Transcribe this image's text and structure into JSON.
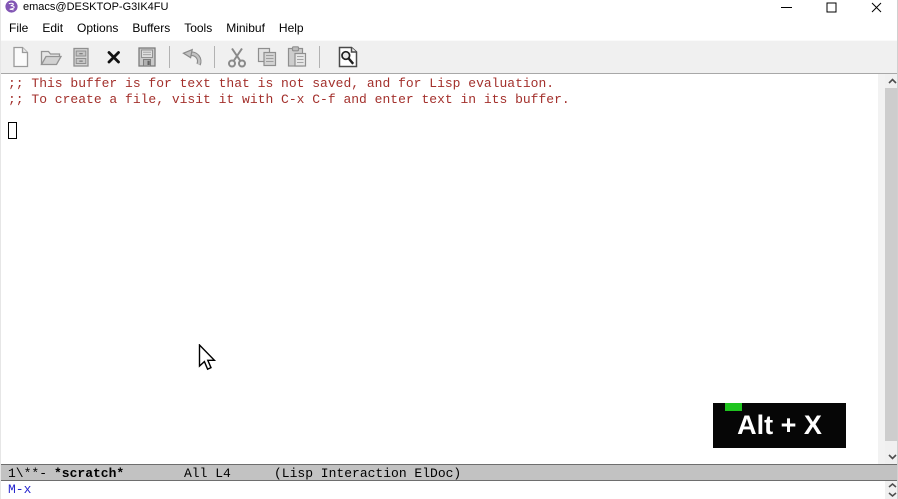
{
  "window": {
    "title": "emacs@DESKTOP-G3IK4FU",
    "controls": [
      {
        "name": "minimize"
      },
      {
        "name": "maximize"
      },
      {
        "name": "close"
      }
    ]
  },
  "menubar": {
    "items": [
      {
        "label": "File"
      },
      {
        "label": "Edit"
      },
      {
        "label": "Options"
      },
      {
        "label": "Buffers"
      },
      {
        "label": "Tools"
      },
      {
        "label": "Minibuf"
      },
      {
        "label": "Help"
      }
    ]
  },
  "toolbar": {
    "items": [
      {
        "name": "new-file-icon"
      },
      {
        "name": "open-folder-icon"
      },
      {
        "name": "dired-cabinet-icon"
      },
      {
        "name": "close-buffer-icon"
      },
      {
        "name": "save-floppy-icon"
      },
      {
        "name": "undo-arrow-icon"
      },
      {
        "name": "cut-scissors-icon"
      },
      {
        "name": "copy-icon"
      },
      {
        "name": "paste-clipboard-icon"
      },
      {
        "name": "isearch-magnifier-icon"
      }
    ]
  },
  "buffer": {
    "lines": [
      ";; This buffer is for text that is not saved, and for Lisp evaluation.",
      ";; To create a file, visit it with C-x C-f and enter text in its buffer."
    ],
    "comment_color": "#a3302c",
    "cursor_style": "hollow-box",
    "cursor_line": 4
  },
  "keycast": {
    "label": "Alt + X",
    "background": "#060606",
    "text_color": "#ffffff",
    "indicator_color": "#1fc41f"
  },
  "modeline": {
    "prefix": "1\\**-",
    "buffer_name": "*scratch*",
    "position": "All L4",
    "modes": "(Lisp Interaction ElDoc)",
    "background": "#c2c2c2"
  },
  "minibuffer": {
    "prompt": "M-x",
    "prompt_color": "#2424cd"
  },
  "scrollbar": {
    "track_color": "#f0f0f0",
    "thumb_color": "#cdcdcd",
    "icons": [
      "scroll-up-arrow",
      "scroll-down-arrow"
    ]
  }
}
